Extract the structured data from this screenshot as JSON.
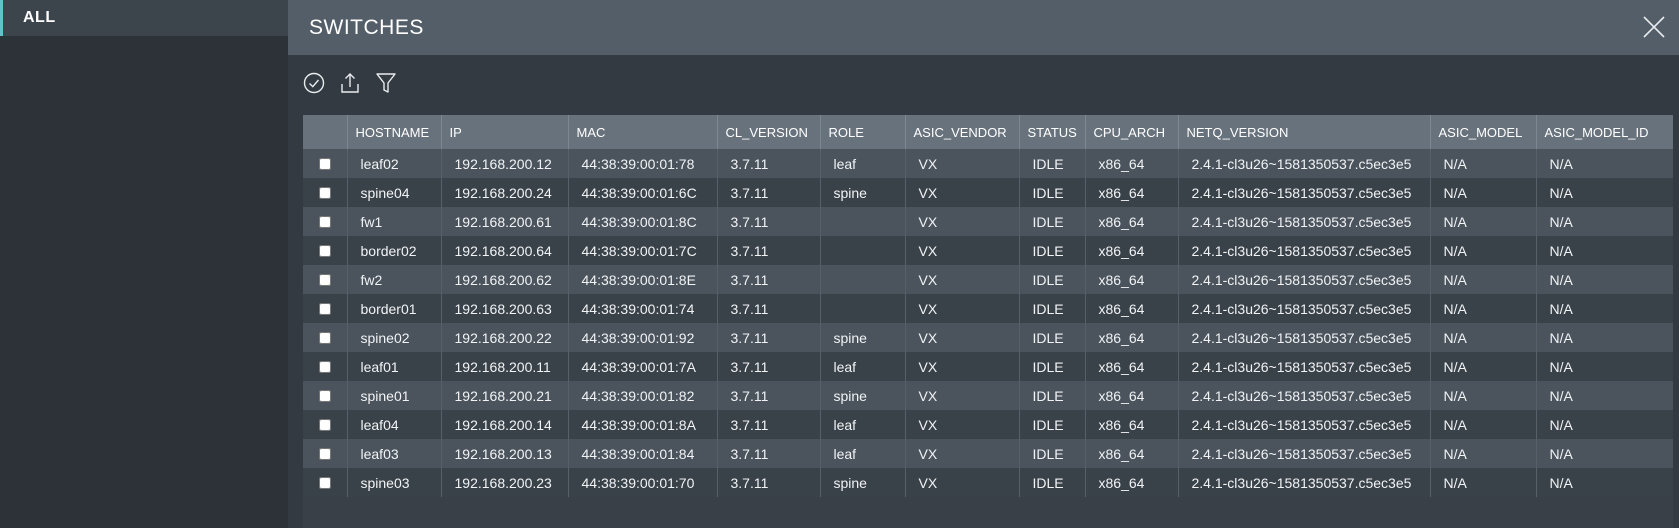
{
  "sidebar": {
    "items": [
      {
        "label": "ALL"
      }
    ]
  },
  "panel": {
    "title": "SWITCHES"
  },
  "toolbar": {
    "icons": [
      "check-circle-icon",
      "upload-icon",
      "filter-icon"
    ]
  },
  "table": {
    "columns": [
      "",
      "HOSTNAME",
      "IP",
      "MAC",
      "CL_VERSION",
      "ROLE",
      "ASIC_VENDOR",
      "STATUS",
      "CPU_ARCH",
      "NETQ_VERSION",
      "ASIC_MODEL",
      "ASIC_MODEL_ID"
    ],
    "rows": [
      [
        "leaf02",
        "192.168.200.12",
        "44:38:39:00:01:78",
        "3.7.11",
        "leaf",
        "VX",
        "IDLE",
        "x86_64",
        "2.4.1-cl3u26~1581350537.c5ec3e5",
        "N/A",
        "N/A"
      ],
      [
        "spine04",
        "192.168.200.24",
        "44:38:39:00:01:6C",
        "3.7.11",
        "spine",
        "VX",
        "IDLE",
        "x86_64",
        "2.4.1-cl3u26~1581350537.c5ec3e5",
        "N/A",
        "N/A"
      ],
      [
        "fw1",
        "192.168.200.61",
        "44:38:39:00:01:8C",
        "3.7.11",
        "",
        "VX",
        "IDLE",
        "x86_64",
        "2.4.1-cl3u26~1581350537.c5ec3e5",
        "N/A",
        "N/A"
      ],
      [
        "border02",
        "192.168.200.64",
        "44:38:39:00:01:7C",
        "3.7.11",
        "",
        "VX",
        "IDLE",
        "x86_64",
        "2.4.1-cl3u26~1581350537.c5ec3e5",
        "N/A",
        "N/A"
      ],
      [
        "fw2",
        "192.168.200.62",
        "44:38:39:00:01:8E",
        "3.7.11",
        "",
        "VX",
        "IDLE",
        "x86_64",
        "2.4.1-cl3u26~1581350537.c5ec3e5",
        "N/A",
        "N/A"
      ],
      [
        "border01",
        "192.168.200.63",
        "44:38:39:00:01:74",
        "3.7.11",
        "",
        "VX",
        "IDLE",
        "x86_64",
        "2.4.1-cl3u26~1581350537.c5ec3e5",
        "N/A",
        "N/A"
      ],
      [
        "spine02",
        "192.168.200.22",
        "44:38:39:00:01:92",
        "3.7.11",
        "spine",
        "VX",
        "IDLE",
        "x86_64",
        "2.4.1-cl3u26~1581350537.c5ec3e5",
        "N/A",
        "N/A"
      ],
      [
        "leaf01",
        "192.168.200.11",
        "44:38:39:00:01:7A",
        "3.7.11",
        "leaf",
        "VX",
        "IDLE",
        "x86_64",
        "2.4.1-cl3u26~1581350537.c5ec3e5",
        "N/A",
        "N/A"
      ],
      [
        "spine01",
        "192.168.200.21",
        "44:38:39:00:01:82",
        "3.7.11",
        "spine",
        "VX",
        "IDLE",
        "x86_64",
        "2.4.1-cl3u26~1581350537.c5ec3e5",
        "N/A",
        "N/A"
      ],
      [
        "leaf04",
        "192.168.200.14",
        "44:38:39:00:01:8A",
        "3.7.11",
        "leaf",
        "VX",
        "IDLE",
        "x86_64",
        "2.4.1-cl3u26~1581350537.c5ec3e5",
        "N/A",
        "N/A"
      ],
      [
        "leaf03",
        "192.168.200.13",
        "44:38:39:00:01:84",
        "3.7.11",
        "leaf",
        "VX",
        "IDLE",
        "x86_64",
        "2.4.1-cl3u26~1581350537.c5ec3e5",
        "N/A",
        "N/A"
      ],
      [
        "spine03",
        "192.168.200.23",
        "44:38:39:00:01:70",
        "3.7.11",
        "spine",
        "VX",
        "IDLE",
        "x86_64",
        "2.4.1-cl3u26~1581350537.c5ec3e5",
        "N/A",
        "N/A"
      ]
    ]
  },
  "colors": {
    "accent": "#5fc4c8",
    "header_bg": "#545e68",
    "table_header_bg": "#68727c"
  }
}
